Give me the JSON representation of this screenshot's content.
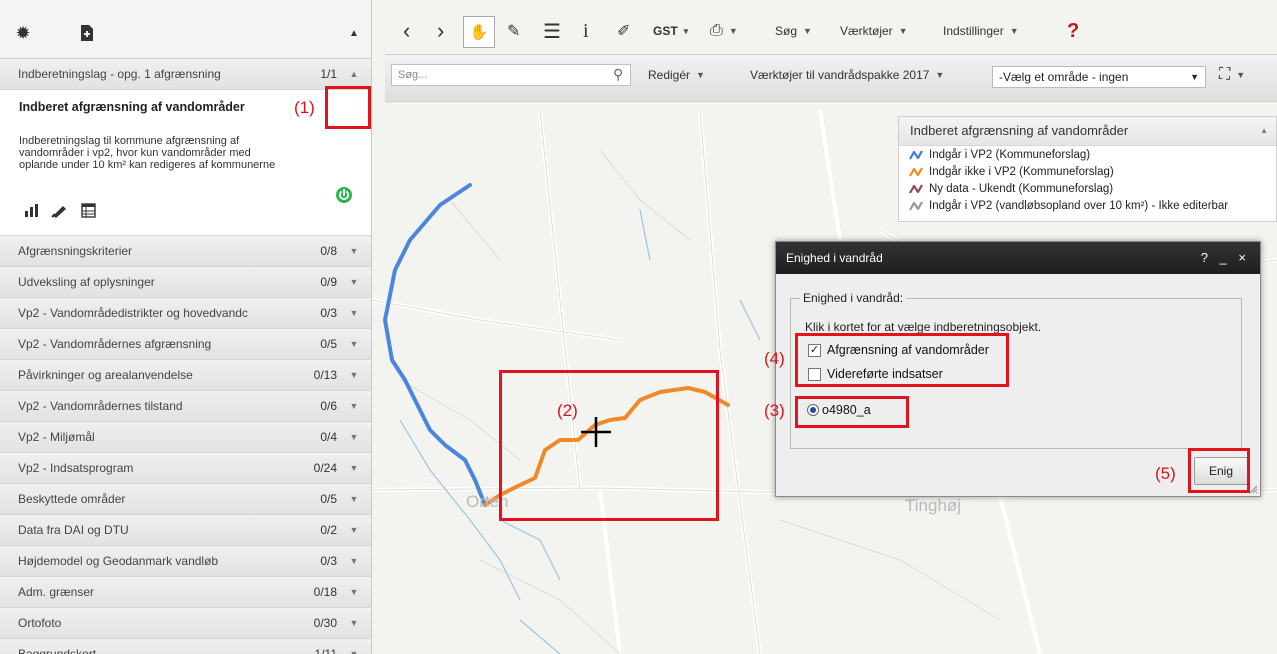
{
  "left_panel": {
    "top_layer": {
      "label": "Indberetningslag - opg. 1 afgrænsning",
      "count": "1/1"
    },
    "open_layer": {
      "title": "Indberet afgrænsning af vandområder",
      "description": "Indberetningslag til kommune afgrænsning af vandområder i vp2, hvor kun vandområder med oplande under 10 km² kan redigeres af kommunerne"
    },
    "layers": [
      {
        "label": "Afgrænsningskriterier",
        "count": "0/8"
      },
      {
        "label": "Udveksling af oplysninger",
        "count": "0/9"
      },
      {
        "label": "Vp2 - Vandområdedistrikter og hovedvandc",
        "count": "0/3"
      },
      {
        "label": "Vp2 - Vandområdernes afgrænsning",
        "count": "0/5"
      },
      {
        "label": "Påvirkninger og arealanvendelse",
        "count": "0/13"
      },
      {
        "label": "Vp2 - Vandområdernes tilstand",
        "count": "0/6"
      },
      {
        "label": "Vp2 - Miljømål",
        "count": "0/4"
      },
      {
        "label": "Vp2 - Indsatsprogram",
        "count": "0/24"
      },
      {
        "label": "Beskyttede områder",
        "count": "0/5"
      },
      {
        "label": "Data fra DAI og DTU",
        "count": "0/2"
      },
      {
        "label": "Højdemodel og Geodanmark vandløb",
        "count": "0/3"
      },
      {
        "label": "Adm. grænser",
        "count": "0/18"
      },
      {
        "label": "Ortofoto",
        "count": "0/30"
      },
      {
        "label": "Baggrundskort",
        "count": "1/11"
      }
    ]
  },
  "toolbar1": {
    "info_label": "i",
    "gst_label": "GST",
    "search_menu": "Søg",
    "tools_menu": "Værktøjer",
    "settings_menu": "Indstillinger",
    "help_label": "?"
  },
  "toolbar2": {
    "search_placeholder": "Søg...",
    "edit_menu": "Redigér",
    "package_menu": "Værktøjer til vandrådspakke 2017",
    "area_select": "-Vælg et område - ingen"
  },
  "legend": {
    "title": "Indberet afgrænsning af vandområder",
    "items": [
      {
        "label": "Indgår i VP2 (Kommuneforslag)",
        "color": "#3d7ee0"
      },
      {
        "label": "Indgår ikke i VP2 (Kommuneforslag)",
        "color": "#f08a24"
      },
      {
        "label": "Ny data - Ukendt (Kommuneforslag)",
        "color": "#8a4a5a"
      },
      {
        "label": "Indgår i VP2 (vandløbsopland over 10 km²) - Ikke editerbar",
        "color": "#999999"
      }
    ]
  },
  "dialog": {
    "title": "Enighed i vandråd",
    "controls": "? _ ×",
    "fieldset_legend": "Enighed i vandråd:",
    "hint": "Klik i kortet for at vælge indberetningsobjekt.",
    "checkbox1": {
      "label": "Afgrænsning af vandområder",
      "checked": true
    },
    "checkbox2": {
      "label": "Videreførte indsatser",
      "checked": false
    },
    "radio_label": "o4980_a",
    "button_label": "Enig"
  },
  "map": {
    "town1": "Orten",
    "town2": "Tinghøj"
  },
  "annotations": {
    "a1": "(1)",
    "a2": "(2)",
    "a3": "(3)",
    "a4": "(4)",
    "a5": "(5)"
  },
  "colors": {
    "blue_line": "#4a86e0",
    "orange_line": "#f0892a",
    "annotation_red": "#e3131b"
  }
}
